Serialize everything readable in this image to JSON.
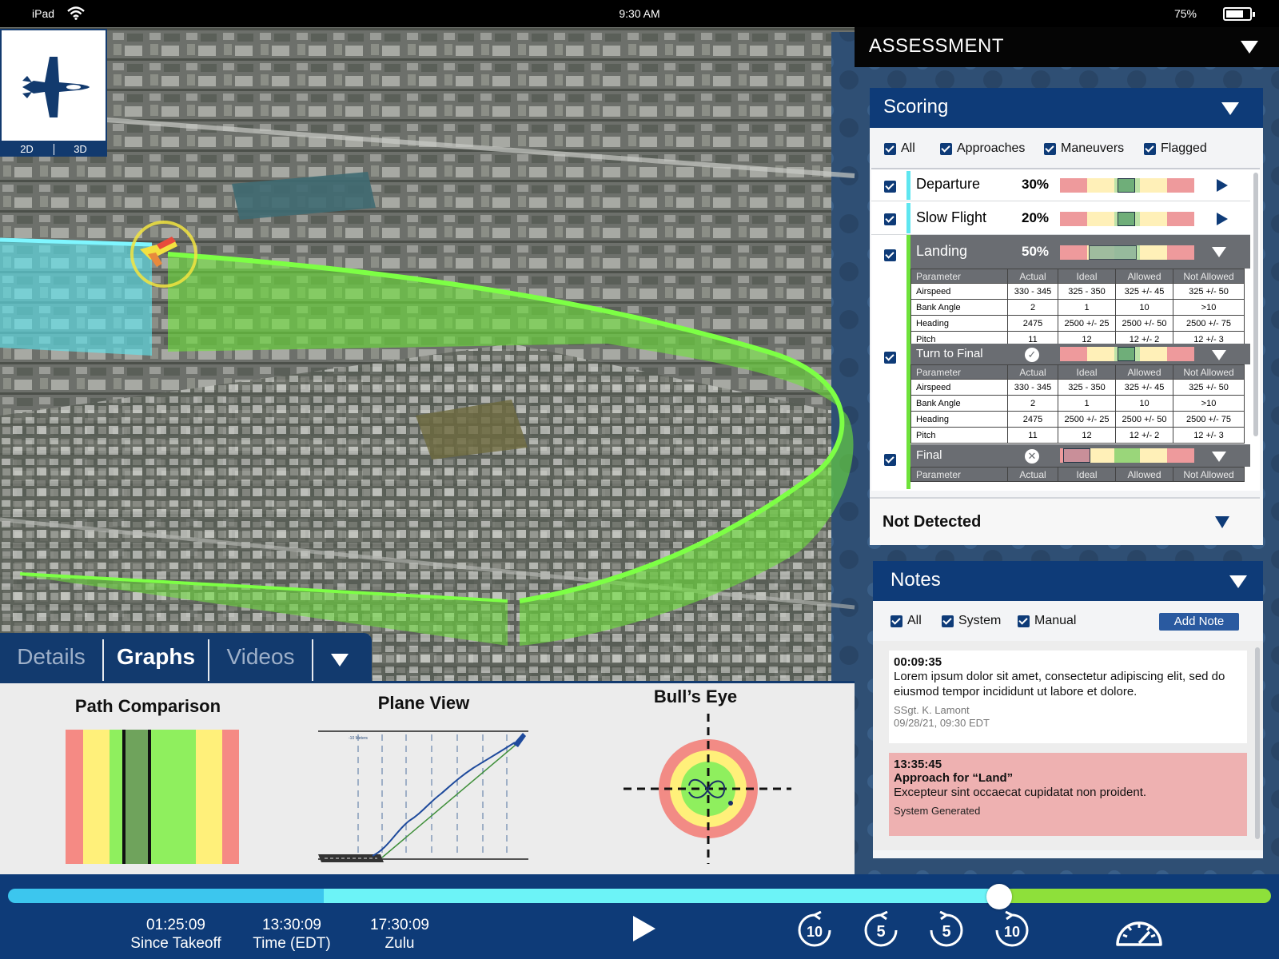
{
  "status_bar": {
    "device": "iPad",
    "time": "9:30 AM",
    "battery": "75%",
    "battery_level": 0.75
  },
  "view_toggle": {
    "options": [
      "2D",
      "3D"
    ]
  },
  "assessment": {
    "title": "ASSESSMENT"
  },
  "scoring": {
    "title": "Scoring",
    "filters": [
      "All",
      "Approaches",
      "Maneuvers",
      "Flagged"
    ],
    "items": [
      {
        "name": "Departure",
        "percent": "30%"
      },
      {
        "name": "Slow Flight",
        "percent": "20%"
      },
      {
        "name": "Landing",
        "percent": "50%"
      }
    ],
    "table_headers": [
      "Parameter",
      "Actual",
      "Ideal",
      "Allowed",
      "Not Allowed"
    ],
    "landing_rows": [
      [
        "Airspeed",
        "330 - 345",
        "325 - 350",
        "325 +/- 45",
        "325 +/- 50"
      ],
      [
        "Bank Angle",
        "2",
        "1",
        "10",
        ">10"
      ],
      [
        "Heading",
        "2475",
        "2500 +/- 25",
        "2500 +/- 50",
        "2500 +/- 75"
      ],
      [
        "Pitch",
        "11",
        "12",
        "12 +/- 2",
        "12 +/- 3"
      ]
    ],
    "sub_items": [
      {
        "name": "Turn to Final",
        "result": "pass"
      },
      {
        "name": "Final",
        "result": "fail"
      }
    ],
    "turn_rows": [
      [
        "Airspeed",
        "330 - 345",
        "325 - 350",
        "325 +/- 45",
        "325 +/- 50"
      ],
      [
        "Bank Angle",
        "2",
        "1",
        "10",
        ">10"
      ],
      [
        "Heading",
        "2475",
        "2500 +/- 25",
        "2500 +/- 50",
        "2500 +/- 75"
      ],
      [
        "Pitch",
        "11",
        "12",
        "12 +/- 2",
        "12 +/- 3"
      ]
    ],
    "not_detected": "Not Detected"
  },
  "notes": {
    "title": "Notes",
    "filters": [
      "All",
      "System",
      "Manual"
    ],
    "add_button": "Add Note",
    "entries": [
      {
        "time": "00:09:35",
        "text": "Lorem ipsum dolor sit amet, consectetur adipiscing elit, sed do eiusmod tempor incididunt ut labore et dolore.",
        "author": "SSgt. K. Lamont",
        "date": "09/28/21, 09:30 EDT"
      },
      {
        "time": "13:35:45",
        "title": "Approach for “Land”",
        "text": "Excepteur sint occaecat cupidatat non proident.",
        "author": "System Generated"
      }
    ]
  },
  "tabs": {
    "items": [
      "Details",
      "Graphs",
      "Videos"
    ],
    "active": "Graphs"
  },
  "graphs": {
    "path_comparison": "Path Comparison",
    "plane_view": "Plane View",
    "plane_axis_label": "-10 Meters",
    "bulls_eye": "Bull’s Eye"
  },
  "timeline": {
    "progress": 0.785,
    "readouts": [
      {
        "value": "01:25:09",
        "label": "Since Takeoff"
      },
      {
        "value": "13:30:09",
        "label": "Time (EDT)"
      },
      {
        "value": "17:30:09",
        "label": "Zulu"
      }
    ],
    "skip_back": [
      "10",
      "5"
    ],
    "skip_forward": [
      "5",
      "10"
    ]
  },
  "colors": {
    "navy": "#0e3b78",
    "green": "#6ee23a",
    "cyan": "#5ee6f0",
    "red": "#f08a8a",
    "yellow": "#fff0a8"
  }
}
